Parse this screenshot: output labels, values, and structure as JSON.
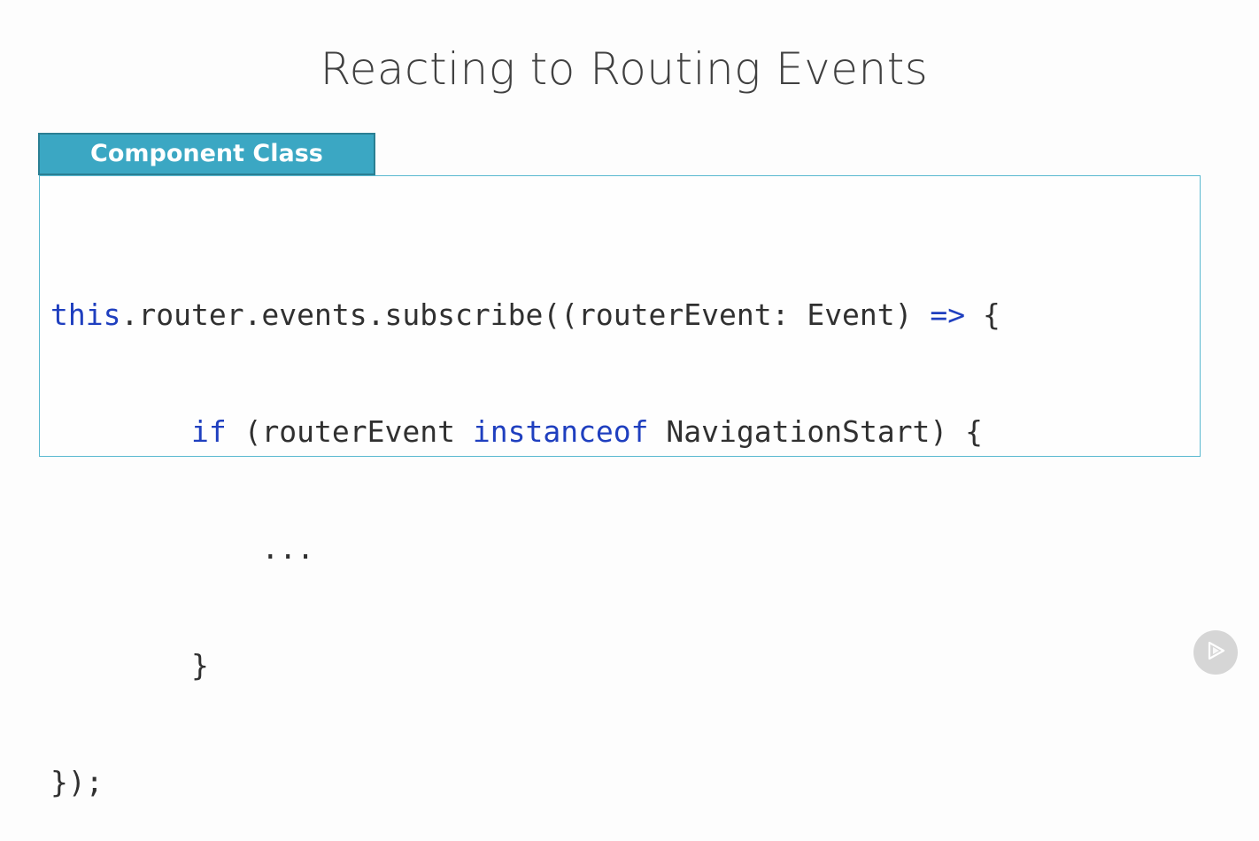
{
  "slide": {
    "title": "Reacting to Routing Events"
  },
  "panel": {
    "tab_label": "Component Class"
  },
  "code": {
    "line1": {
      "kw_this": "this",
      "rest1": ".router.events.subscribe((routerEvent: Event) ",
      "kw_arrow": "=>",
      "rest2": " {"
    },
    "line2": {
      "indent": "        ",
      "kw_if": "if",
      "rest1": " (routerEvent ",
      "kw_instanceof": "instanceof",
      "rest2": " NavigationStart) {"
    },
    "line3": "            ...",
    "line4": "        }",
    "line5": "});"
  },
  "colors": {
    "keyword": "#1f3fbf",
    "tab_background": "#3ba7c3",
    "box_border": "#5ab9d0"
  },
  "icons": {
    "player": "play-icon"
  }
}
